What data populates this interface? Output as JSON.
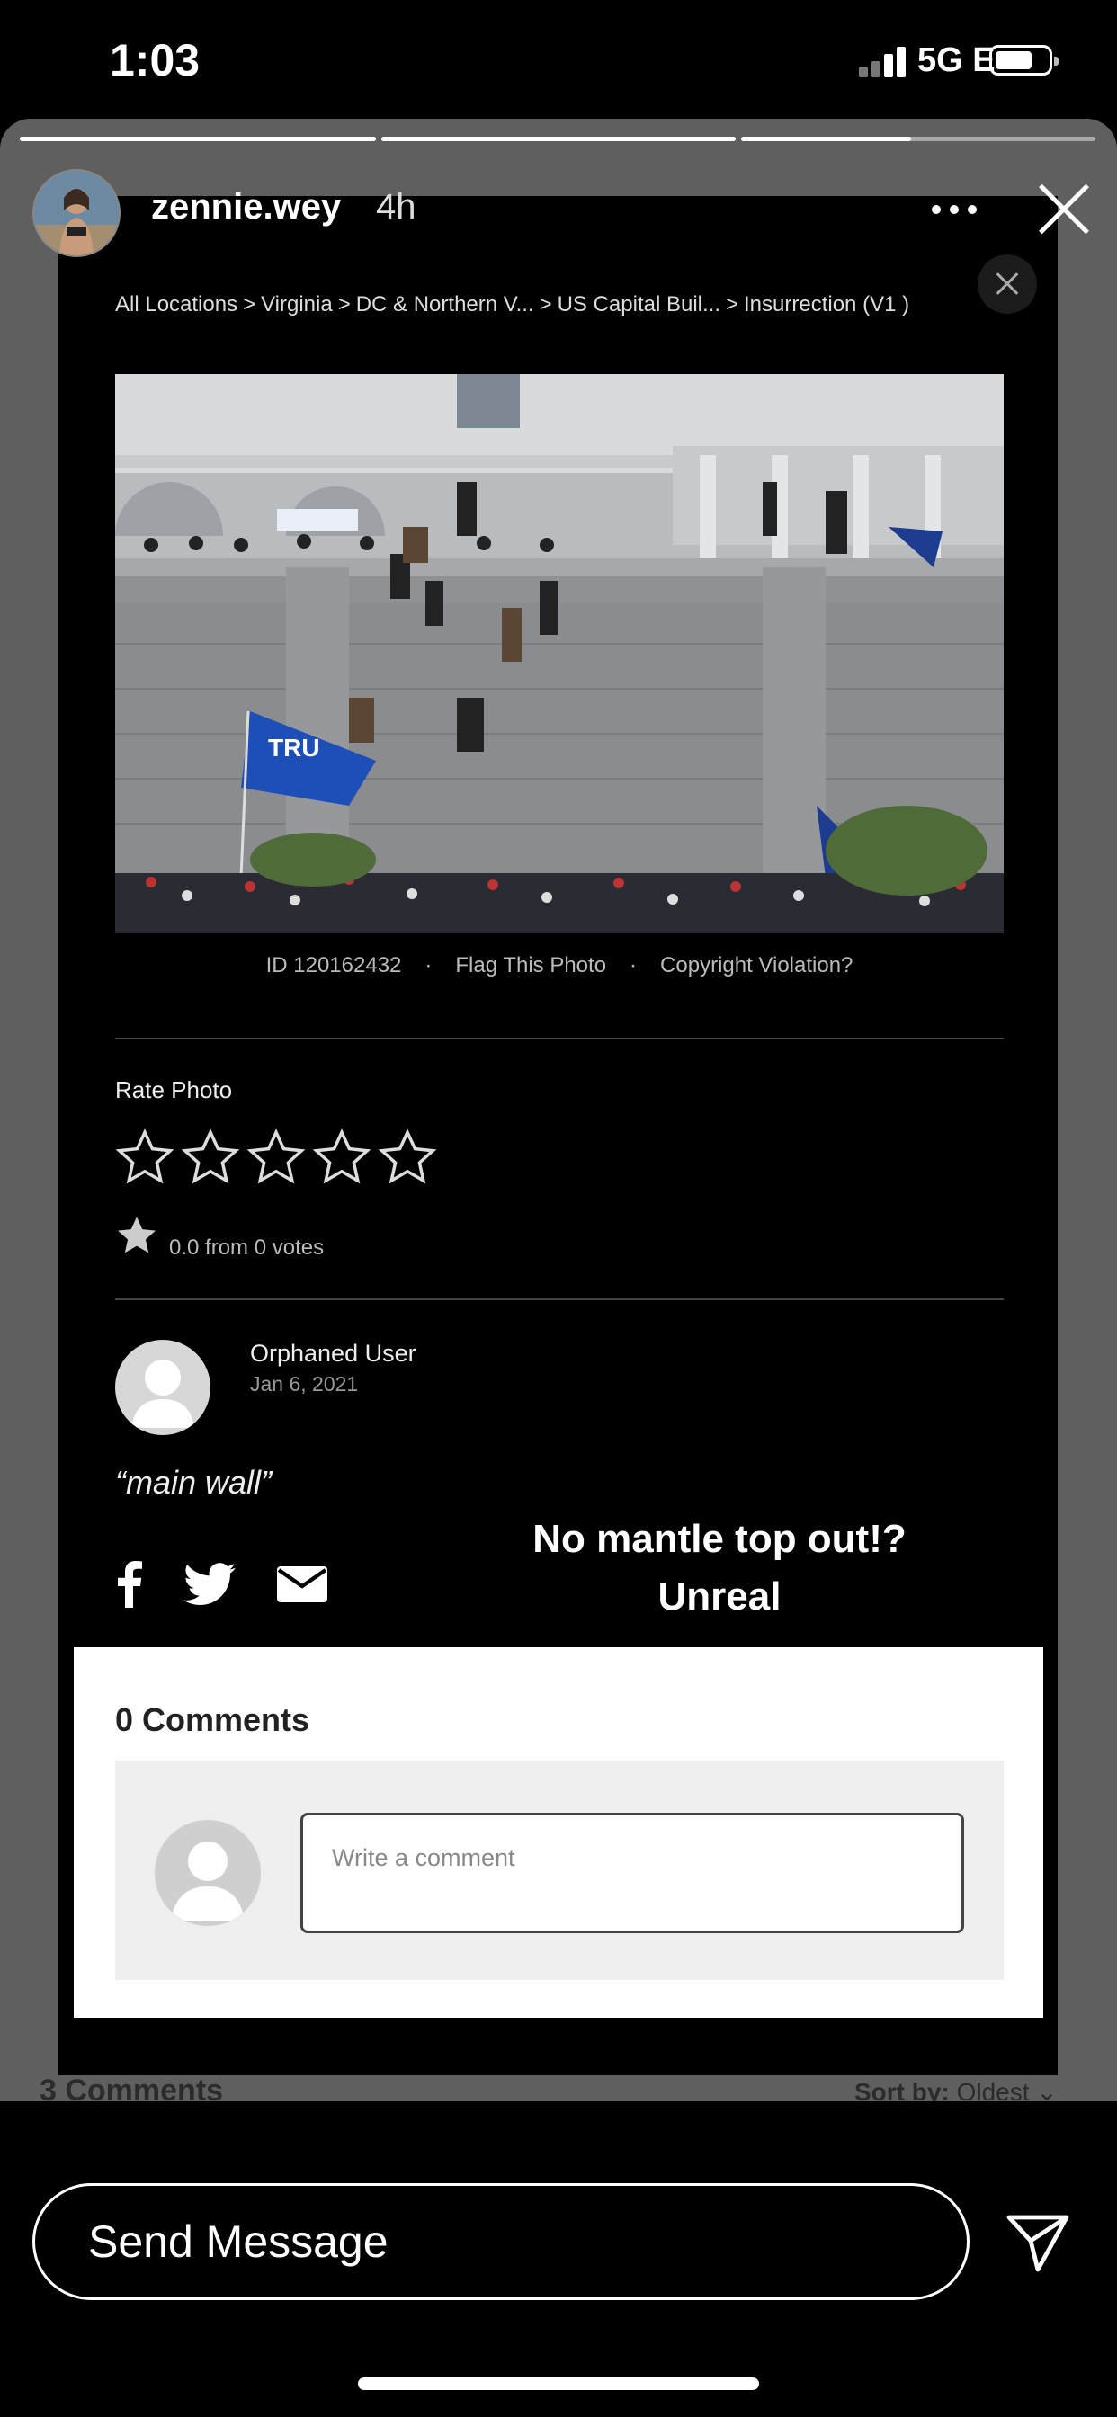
{
  "status_bar": {
    "time": "1:03",
    "network": "5G E"
  },
  "story": {
    "username": "zennie.wey",
    "time_ago": "4h",
    "segments_progress": [
      1.0,
      1.0,
      0.48
    ]
  },
  "background_page": {
    "comments_heading": "3 Comments",
    "sort_label": "Sort by:",
    "sort_value": "Oldest"
  },
  "breadcrumb": [
    "All Locations",
    "Virginia",
    "DC & Northern V...",
    "US Capital Buil...",
    "Insurrection (V1 )"
  ],
  "photo_meta": {
    "id": "ID 120162432",
    "flag": "Flag This Photo",
    "copyright": "Copyright Violation?"
  },
  "rating": {
    "label": "Rate Photo",
    "stars_total": 5,
    "stars_filled": 0,
    "summary": "0.0 from 0 votes"
  },
  "poster": {
    "name": "Orphaned User",
    "date": "Jan 6, 2021",
    "caption": "“main wall”"
  },
  "overlay_caption": [
    "No mantle top out!?",
    "Unreal"
  ],
  "share_icons": [
    "facebook-icon",
    "twitter-icon",
    "email-icon"
  ],
  "comments": {
    "title": "0 Comments",
    "placeholder": "Write a comment"
  },
  "message_bar": {
    "placeholder": "Send Message"
  },
  "colors": {
    "background": "#000000",
    "comments_panel": "#ffffff",
    "story_backdrop": "#5f5f5f"
  }
}
